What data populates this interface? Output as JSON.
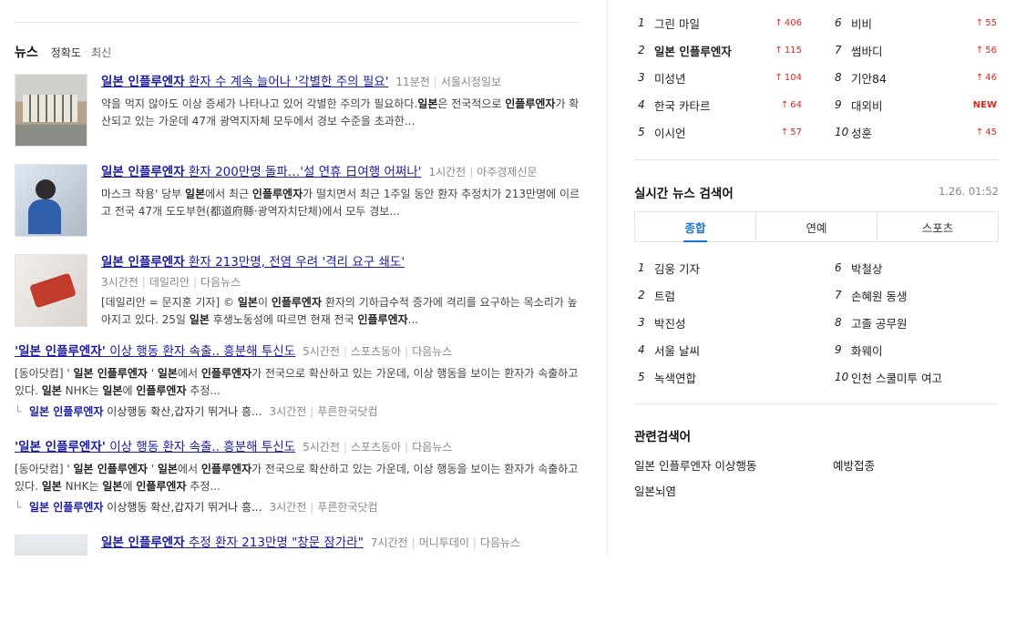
{
  "news": {
    "title": "뉴스",
    "sort_accuracy": "정확도",
    "sort_latest": "최신",
    "items": [
      {
        "title_bold": "일본 인플루엔자",
        "title_rest": " 환자 수 계속 늘어나 '각별한 주의 필요'",
        "time": "11분전",
        "source": "서울시정일보",
        "desc_html_parts": [
          [
            "약을 먹지 않아도 이상 증세가 나타나고 있어 각별한 주의가 필요하다.",
            false
          ],
          [
            "일본",
            true
          ],
          [
            "은 전국적으로 ",
            false
          ],
          [
            "인플루엔자",
            true
          ],
          [
            "가 확산되고 있는 가운데 47개 광역지자체 모두에서 경보 수준을 초과한...",
            false
          ]
        ]
      },
      {
        "title_bold": "일본 인플루엔자",
        "title_rest": " 환자 200만명 돌파…'설 연휴 日여행 어쩌나'",
        "time": "1시간전",
        "source": "아주경제신문",
        "desc_html_parts": [
          [
            "마스크 착용' 당부 ",
            false
          ],
          [
            "일본",
            true
          ],
          [
            "에서 최근 ",
            false
          ],
          [
            "인플루엔자",
            true
          ],
          [
            "가 떨치면서 최근 1주일 동안 환자 추정치가 213만명에 이르고 전국 47개 도도부현(都道府縣·광역자치단체)에서 모두 경보...",
            false
          ]
        ]
      },
      {
        "title_bold": "일본 인플루엔자",
        "title_rest": " 환자 213만명, 전염 우려 '격리 요구 쇄도'",
        "time": "3시간전",
        "source": "데일리안",
        "portal": "다음뉴스",
        "desc_html_parts": [
          [
            "[데일리안 = 문지훈 기자] © ",
            false
          ],
          [
            "일본",
            true
          ],
          [
            "이 ",
            false
          ],
          [
            "인플루엔자",
            true
          ],
          [
            " 환자의 기하급수적 증가에 격리를 요구하는 목소리가 높아지고 있다. 25일 ",
            false
          ],
          [
            "일본",
            true
          ],
          [
            " 후생노동성에 따르면 현재 전국 ",
            false
          ],
          [
            "인플루엔자",
            true
          ],
          [
            "...",
            false
          ]
        ]
      },
      {
        "title_bold": "'일본 인플루엔자'",
        "title_rest": " 이상 행동 환자 속출.. 흥분해 투신도",
        "time": "5시간전",
        "source": "스포츠동아",
        "portal": "다음뉴스",
        "desc_html_parts": [
          [
            "[동아닷컴] ' ",
            false
          ],
          [
            "일본 인플루엔자",
            true
          ],
          [
            " ' ",
            false
          ],
          [
            "일본",
            true
          ],
          [
            "에서 ",
            false
          ],
          [
            "인플루엔자",
            true
          ],
          [
            "가 전국으로 확산하고 있는 가운데, 이상 행동을 보이는 환자가 속출하고 있다. ",
            false
          ],
          [
            "일본",
            true
          ],
          [
            " NHK는 ",
            false
          ],
          [
            "일본",
            true
          ],
          [
            "에 ",
            false
          ],
          [
            "인플루엔자",
            true
          ],
          [
            " 추정...",
            false
          ]
        ],
        "related_bold": "일본 인플루엔자",
        "related_rest": " 이상행동 확산,갑자기 뛰거나 흥...",
        "related_time": "3시간전",
        "related_source": "푸른한국닷컴"
      },
      {
        "title_bold": "'일본 인플루엔자'",
        "title_rest": " 이상 행동 환자 속출.. 흥분해 투신도",
        "time": "5시간전",
        "source": "스포츠동아",
        "portal": "다음뉴스",
        "desc_html_parts": [
          [
            "[동아닷컴] ' ",
            false
          ],
          [
            "일본 인플루엔자",
            true
          ],
          [
            " ' ",
            false
          ],
          [
            "일본",
            true
          ],
          [
            "에서 ",
            false
          ],
          [
            "인플루엔자",
            true
          ],
          [
            "가 전국으로 확산하고 있는 가운데, 이상 행동을 보이는 환자가 속출하고 있다. ",
            false
          ],
          [
            "일본",
            true
          ],
          [
            " NHK는 ",
            false
          ],
          [
            "일본",
            true
          ],
          [
            "에 ",
            false
          ],
          [
            "인플루엔자",
            true
          ],
          [
            " 추정...",
            false
          ]
        ],
        "related_bold": "일본 인플루엔자",
        "related_rest": " 이상행동 확산,갑자기 뛰거나 흥...",
        "related_time": "3시간전",
        "related_source": "푸른한국닷컴"
      },
      {
        "title_bold": "일본 인플루엔자",
        "title_rest": " 추정 환자 213만명 \"창문 잠가라\"",
        "time": "7시간전",
        "source": "머니투데이",
        "portal": "다음뉴스"
      }
    ]
  },
  "rank": {
    "items": [
      {
        "num": "1",
        "name": "그린 마일",
        "change": "406",
        "bold": false
      },
      {
        "num": "2",
        "name": "일본 인플루엔자",
        "change": "115",
        "bold": true
      },
      {
        "num": "3",
        "name": "미성년",
        "change": "104",
        "bold": false
      },
      {
        "num": "4",
        "name": "한국 카타르",
        "change": "64",
        "bold": false
      },
      {
        "num": "5",
        "name": "이시언",
        "change": "57",
        "bold": false
      },
      {
        "num": "6",
        "name": "비비",
        "change": "55",
        "bold": false
      },
      {
        "num": "7",
        "name": "썸바디",
        "change": "56",
        "bold": false
      },
      {
        "num": "8",
        "name": "기안84",
        "change": "46",
        "bold": false
      },
      {
        "num": "9",
        "name": "대외비",
        "change": "NEW",
        "bold": false
      },
      {
        "num": "10",
        "name": "성훈",
        "change": "45",
        "bold": false
      }
    ],
    "arrow": "↑"
  },
  "realtime": {
    "title": "실시간 뉴스 검색어",
    "time": "1.26. 01:52",
    "tabs": [
      "종합",
      "연예",
      "스포츠"
    ],
    "items": [
      {
        "num": "1",
        "name": "김웅 기자"
      },
      {
        "num": "2",
        "name": "트럼"
      },
      {
        "num": "3",
        "name": "박진성"
      },
      {
        "num": "4",
        "name": "서울 날씨"
      },
      {
        "num": "5",
        "name": "녹색연합"
      },
      {
        "num": "6",
        "name": "박철상"
      },
      {
        "num": "7",
        "name": "손혜원 동생"
      },
      {
        "num": "8",
        "name": "고졸 공무원"
      },
      {
        "num": "9",
        "name": "화웨이"
      },
      {
        "num": "10",
        "name": "인천 스쿨미투 여고"
      }
    ]
  },
  "related": {
    "title": "관련검색어",
    "items": [
      "일본 인플루엔자 이상행동",
      "예방접종",
      "일본뇌염"
    ]
  }
}
